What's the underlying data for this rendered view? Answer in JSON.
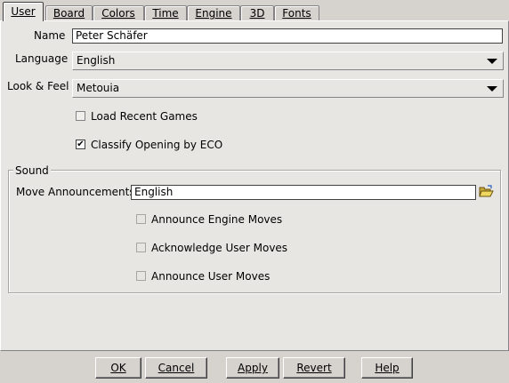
{
  "tabs": [
    {
      "label": "User"
    },
    {
      "label": "Board"
    },
    {
      "label": "Colors"
    },
    {
      "label": "Time"
    },
    {
      "label": "Engine"
    },
    {
      "label": "3D"
    },
    {
      "label": "Fonts"
    }
  ],
  "user": {
    "name_label": "Name",
    "name_value": "Peter Schäfer",
    "language_label": "Language",
    "language_value": "English",
    "lookfeel_label": "Look & Feel",
    "lookfeel_value": "Metouia",
    "load_recent_label": "Load Recent Games",
    "load_recent_checked": false,
    "classify_label": "Classify Opening by ECO",
    "classify_checked": true
  },
  "sound": {
    "group_title": "Sound",
    "move_ann_label": "Move Announcements:",
    "move_ann_value": "English",
    "announce_engine_label": "Announce Engine Moves",
    "ack_user_label": "Acknowledge User Moves",
    "announce_user_label": "Announce User Moves"
  },
  "buttons": {
    "ok": "OK",
    "cancel": "Cancel",
    "apply": "Apply",
    "revert": "Revert",
    "help": "Help"
  },
  "icons": {
    "folder": "folder-open-icon",
    "dropdown": "chevron-down-icon",
    "check": "check-icon"
  }
}
